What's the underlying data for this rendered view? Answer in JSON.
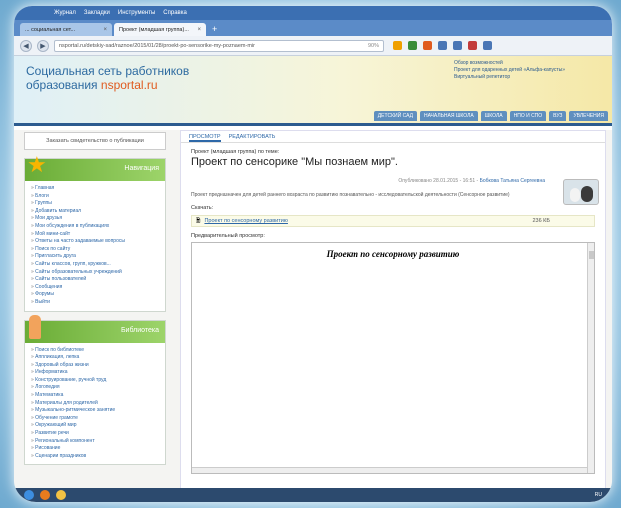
{
  "browser": {
    "menu": [
      "Журнал",
      "Закладки",
      "Инструменты",
      "Справка"
    ],
    "tabs": [
      {
        "label": "... социальная сет...",
        "active": false
      },
      {
        "label": "Проект (младшая группа)...",
        "active": true
      }
    ],
    "url": "nsportal.ru/detskiy-sad/raznoe/2015/01/28/proekt-po-sensorike-my-poznaem-mir",
    "zoom": "90%"
  },
  "site": {
    "logo_line1": "Социальная сеть работников",
    "logo_line2_prefix": "образования ",
    "logo_line2_accent": "nsportal.ru",
    "promo": [
      "Обзор возможностей",
      "Проект для одаренных детей «Альфа-капусты»",
      "Виртуальный репетитор"
    ],
    "topnav": [
      "ДЕТСКИЙ САД",
      "НАЧАЛЬНАЯ ШКОЛА",
      "ШКОЛА",
      "НПО И СПО",
      "ВУЗ",
      "УВЛЕЧЕНИЯ"
    ]
  },
  "sidebar": {
    "cert_button": "Заказать свидетельство о публикации",
    "nav_title": "Навигация",
    "nav_items": [
      "Главная",
      "Блоги",
      "Группы",
      "Добавить материал",
      "Мои друзья",
      "Мои обсуждения в публикациях",
      "Мой мини-сайт",
      "Ответы на часто задаваемые вопросы",
      "Поиск по сайту",
      "Пригласить друга",
      "Сайты классов, групп, кружков...",
      "Сайты образовательных учреждений",
      "Сайты пользователей",
      "Сообщения",
      "Форумы",
      "Выйти"
    ],
    "lib_title": "Библиотека",
    "lib_items": [
      "Поиск по библиотеке",
      "Аппликация, лепка",
      "Здоровый образ жизни",
      "Информатика",
      "Конструирование, ручной труд",
      "Логопедия",
      "Математика",
      "Материалы для родителей",
      "Музыкально-ритмическое занятие",
      "Обучение грамоте",
      "Окружающий мир",
      "Развитие речи",
      "Региональный компонент",
      "Рисование",
      "Сценарии праздников"
    ]
  },
  "main": {
    "tab_view": "ПРОСМОТР",
    "tab_edit": "РЕДАКТИРОВАТЬ",
    "crumb": "Проект (младшая группа) по теме:",
    "title": "Проект по сенсорике \"Мы познаем мир\".",
    "published": "Опубликовано 28.01.2015 - 16:51 - ",
    "author": "Бобкова Татьяна Сергеевна",
    "description": "Проект предназначен для детей раннего возраста по развитию познавательно - исследовательской деятельности (Сенсорное развитие)",
    "downloads_label": "Скачать:",
    "file_name": "Проект по сенсорному развитию",
    "file_size": "236 КБ",
    "preview_label": "Предварительный просмотр:",
    "doc_heading": "Проект по сенсорному развитию"
  },
  "taskbar": {
    "tray": "RU"
  }
}
